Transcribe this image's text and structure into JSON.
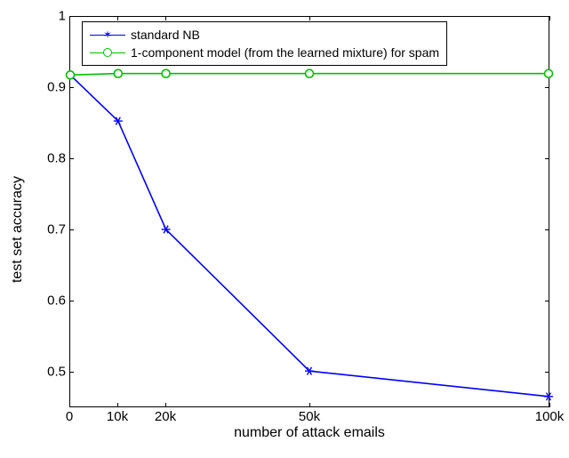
{
  "chart_data": {
    "type": "line",
    "xlabel": "number of attack emails",
    "ylabel": "test set accuracy",
    "xlim": [
      0,
      100000
    ],
    "ylim": [
      0.45,
      1.0
    ],
    "xticks": [
      {
        "v": 0,
        "label": "0"
      },
      {
        "v": 10000,
        "label": "10k"
      },
      {
        "v": 20000,
        "label": "20k"
      },
      {
        "v": 50000,
        "label": "50k"
      },
      {
        "v": 100000,
        "label": "100k"
      }
    ],
    "yticks": [
      {
        "v": 0.5,
        "label": "0.5"
      },
      {
        "v": 0.6,
        "label": "0.6"
      },
      {
        "v": 0.7,
        "label": "0.7"
      },
      {
        "v": 0.8,
        "label": "0.8"
      },
      {
        "v": 0.9,
        "label": "0.9"
      },
      {
        "v": 1.0,
        "label": "1"
      }
    ],
    "series": [
      {
        "name": "standard NB",
        "color": "#0000ff",
        "marker": "star",
        "x": [
          0,
          10000,
          20000,
          50000,
          100000
        ],
        "y": [
          0.918,
          0.853,
          0.7,
          0.5,
          0.464
        ]
      },
      {
        "name": "1-component model (from the learned mixture) for spam",
        "color": "#00c000",
        "marker": "circle",
        "x": [
          0,
          10000,
          20000,
          50000,
          100000
        ],
        "y": [
          0.918,
          0.92,
          0.92,
          0.92,
          0.92
        ]
      }
    ]
  }
}
